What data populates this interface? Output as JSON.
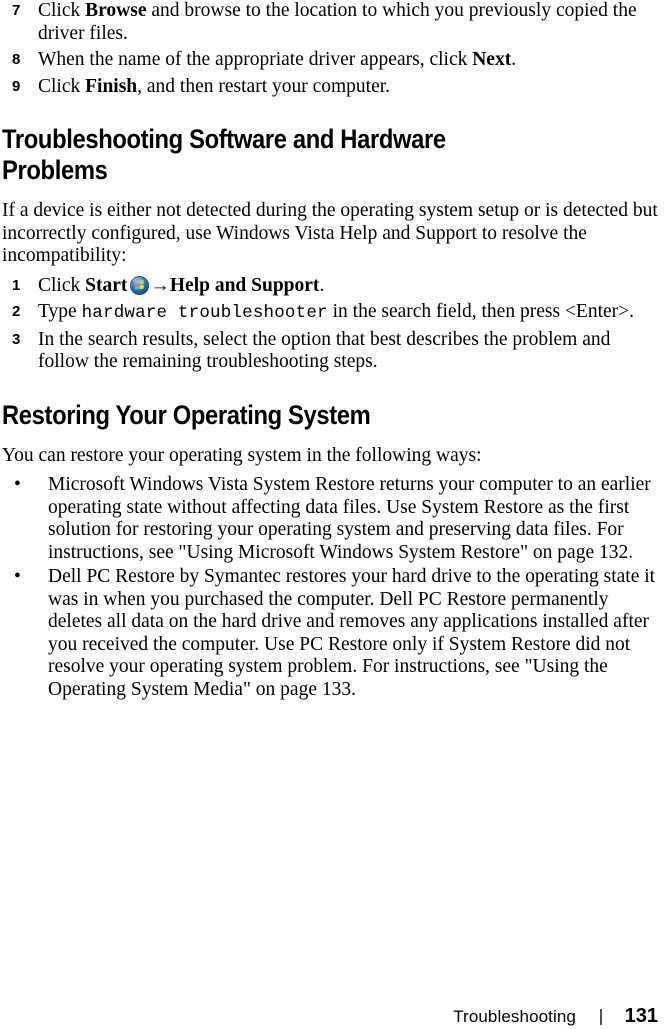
{
  "document": {
    "page_number": "131",
    "footer_section": "Troubleshooting",
    "footer_separator": "|"
  },
  "driver_steps": [
    {
      "number": "7",
      "pre": "Click ",
      "bold": "Browse",
      "post": " and browse to the location to which you previously copied the driver files."
    },
    {
      "number": "8",
      "pre": "When the name of the appropriate driver appears, click ",
      "bold": "Next",
      "post": "."
    },
    {
      "number": "9",
      "pre": "Click ",
      "bold": "Finish",
      "post": ", and then restart your computer."
    }
  ],
  "section_troubleshooting": {
    "heading_line1": "Troubleshooting Software and Hardware",
    "heading_line2": "Problems",
    "intro": "If a device is either not detected during the operating system setup or is detected but incorrectly configured, use Windows Vista Help and Support to resolve the incompatibility:",
    "steps": [
      {
        "number": "1",
        "pre": "Click ",
        "bold_start": "Start",
        "icon": "windows-start-orb-icon",
        "arrow": "→",
        "bold_target": "Help and Support",
        "post": "."
      },
      {
        "number": "2",
        "pre": "Type ",
        "mono": "hardware troubleshooter",
        "post": " in the search field, then press <Enter>."
      },
      {
        "number": "3",
        "text": "In the search results, select the option that best describes the problem and follow the remaining troubleshooting steps."
      }
    ]
  },
  "section_restoring": {
    "heading": "Restoring Your Operating System",
    "intro": "You can restore your operating system in the following ways:",
    "bullet_mark": "•",
    "bullets": [
      {
        "text": "Microsoft Windows Vista System Restore returns your computer to an earlier operating state without affecting data files. Use System Restore as the first solution for restoring your operating system and preserving data files. For instructions, see \"Using Microsoft Windows System Restore\" on page 132."
      },
      {
        "text": "Dell PC Restore by Symantec restores your hard drive to the operating state it was in when you purchased the computer. Dell PC Restore permanently deletes all data on the hard drive and removes any applications installed after you received the computer. Use PC Restore only if System Restore did not resolve your operating system problem. For instructions, see \"Using the Operating System Media\" on page 133."
      }
    ]
  },
  "colors": {
    "text": "#000000",
    "background": "#ffffff",
    "orb_blue_outer": "#1f5fa8",
    "orb_blue_inner": "#3f8fd8",
    "flag_red": "#e8562a",
    "flag_green": "#8cc63f",
    "flag_blue": "#2b9fe0",
    "flag_yellow": "#f5c518"
  }
}
